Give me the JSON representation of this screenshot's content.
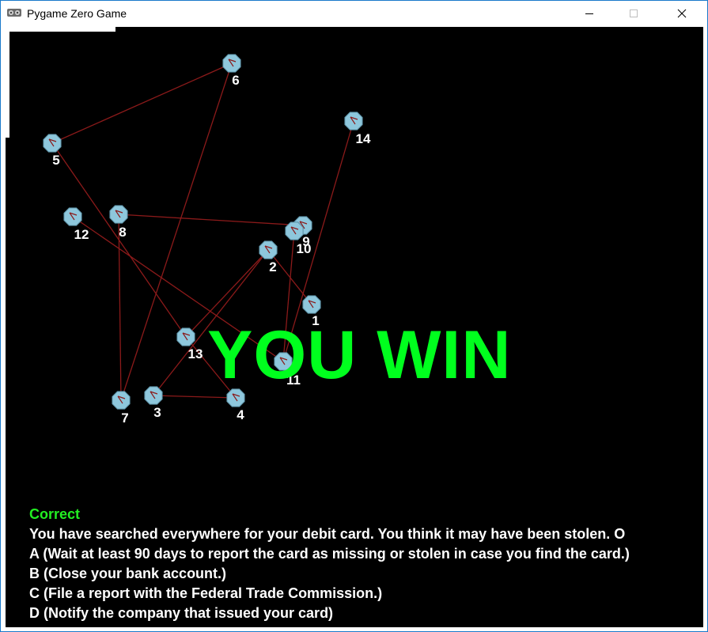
{
  "window": {
    "title": "Pygame Zero Game"
  },
  "game": {
    "win_text": "YOU WIN",
    "status": "Correct",
    "question": "You have searched everywhere for your debit card. You think it may have been stolen. O",
    "options": [
      "A (Wait at least 90 days to report the card as missing or stolen in case you find the card.)",
      "B (Close your bank account.)",
      "C (File a report with the Federal Trade Commission.)",
      "D (Notify the company that issued your card)"
    ]
  },
  "nodes": [
    {
      "label": "1"
    },
    {
      "label": "2"
    },
    {
      "label": "3"
    },
    {
      "label": "4"
    },
    {
      "label": "5"
    },
    {
      "label": "6"
    },
    {
      "label": "7"
    },
    {
      "label": "8"
    },
    {
      "label": "9"
    },
    {
      "label": "10"
    },
    {
      "label": "11"
    },
    {
      "label": "12"
    },
    {
      "label": "13"
    },
    {
      "label": "14"
    }
  ],
  "colors": {
    "node_fill": "#8ec7dc",
    "edge": "#8b1a1a",
    "win": "#00ff1e",
    "status": "#22ee22",
    "text": "#ffffff",
    "background": "#000000"
  }
}
